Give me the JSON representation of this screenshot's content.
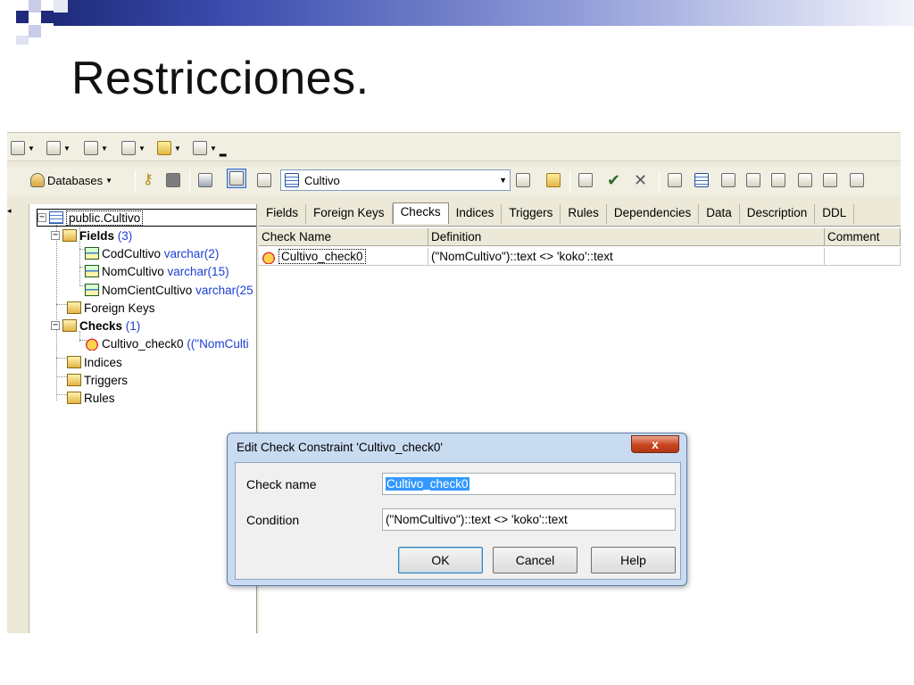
{
  "slide": {
    "title": "Restricciones."
  },
  "toolbar": {
    "databases_label": "Databases",
    "object_combo_value": "Cultivo"
  },
  "tree": {
    "root": "public.Cultivo",
    "fields_label": "Fields",
    "fields_count": "(3)",
    "fields": [
      {
        "name": "CodCultivo",
        "type": "varchar(2)"
      },
      {
        "name": "NomCultivo",
        "type": "varchar(15)"
      },
      {
        "name": "NomCientCultivo",
        "type": "varchar(25"
      }
    ],
    "foreign_keys": "Foreign Keys",
    "checks_label": "Checks",
    "checks_count": "(1)",
    "check_item_name": "Cultivo_check0",
    "check_item_def": "((\"NomCulti",
    "indices": "Indices",
    "triggers": "Triggers",
    "rules": "Rules"
  },
  "tabs": [
    "Fields",
    "Foreign Keys",
    "Checks",
    "Indices",
    "Triggers",
    "Rules",
    "Dependencies",
    "Data",
    "Description",
    "DDL"
  ],
  "grid": {
    "headers": [
      "Check Name",
      "Definition",
      "Comment"
    ],
    "row": {
      "name": "Cultivo_check0",
      "definition": "(\"NomCultivo\")::text <> 'koko'::text",
      "comment": ""
    }
  },
  "dialog": {
    "title": "Edit Check Constraint 'Cultivo_check0'",
    "close_glyph": "x",
    "check_name_label": "Check name",
    "check_name_value": "Cultivo_check0",
    "condition_label": "Condition",
    "condition_value": "(\"NomCultivo\")::text <> 'koko'::text",
    "ok": "OK",
    "cancel": "Cancel",
    "help": "Help"
  },
  "colors": {
    "deco_dark": "#1f2a7a",
    "deco_light": "#8f9bd8",
    "link_blue": "#1a3fd1"
  }
}
